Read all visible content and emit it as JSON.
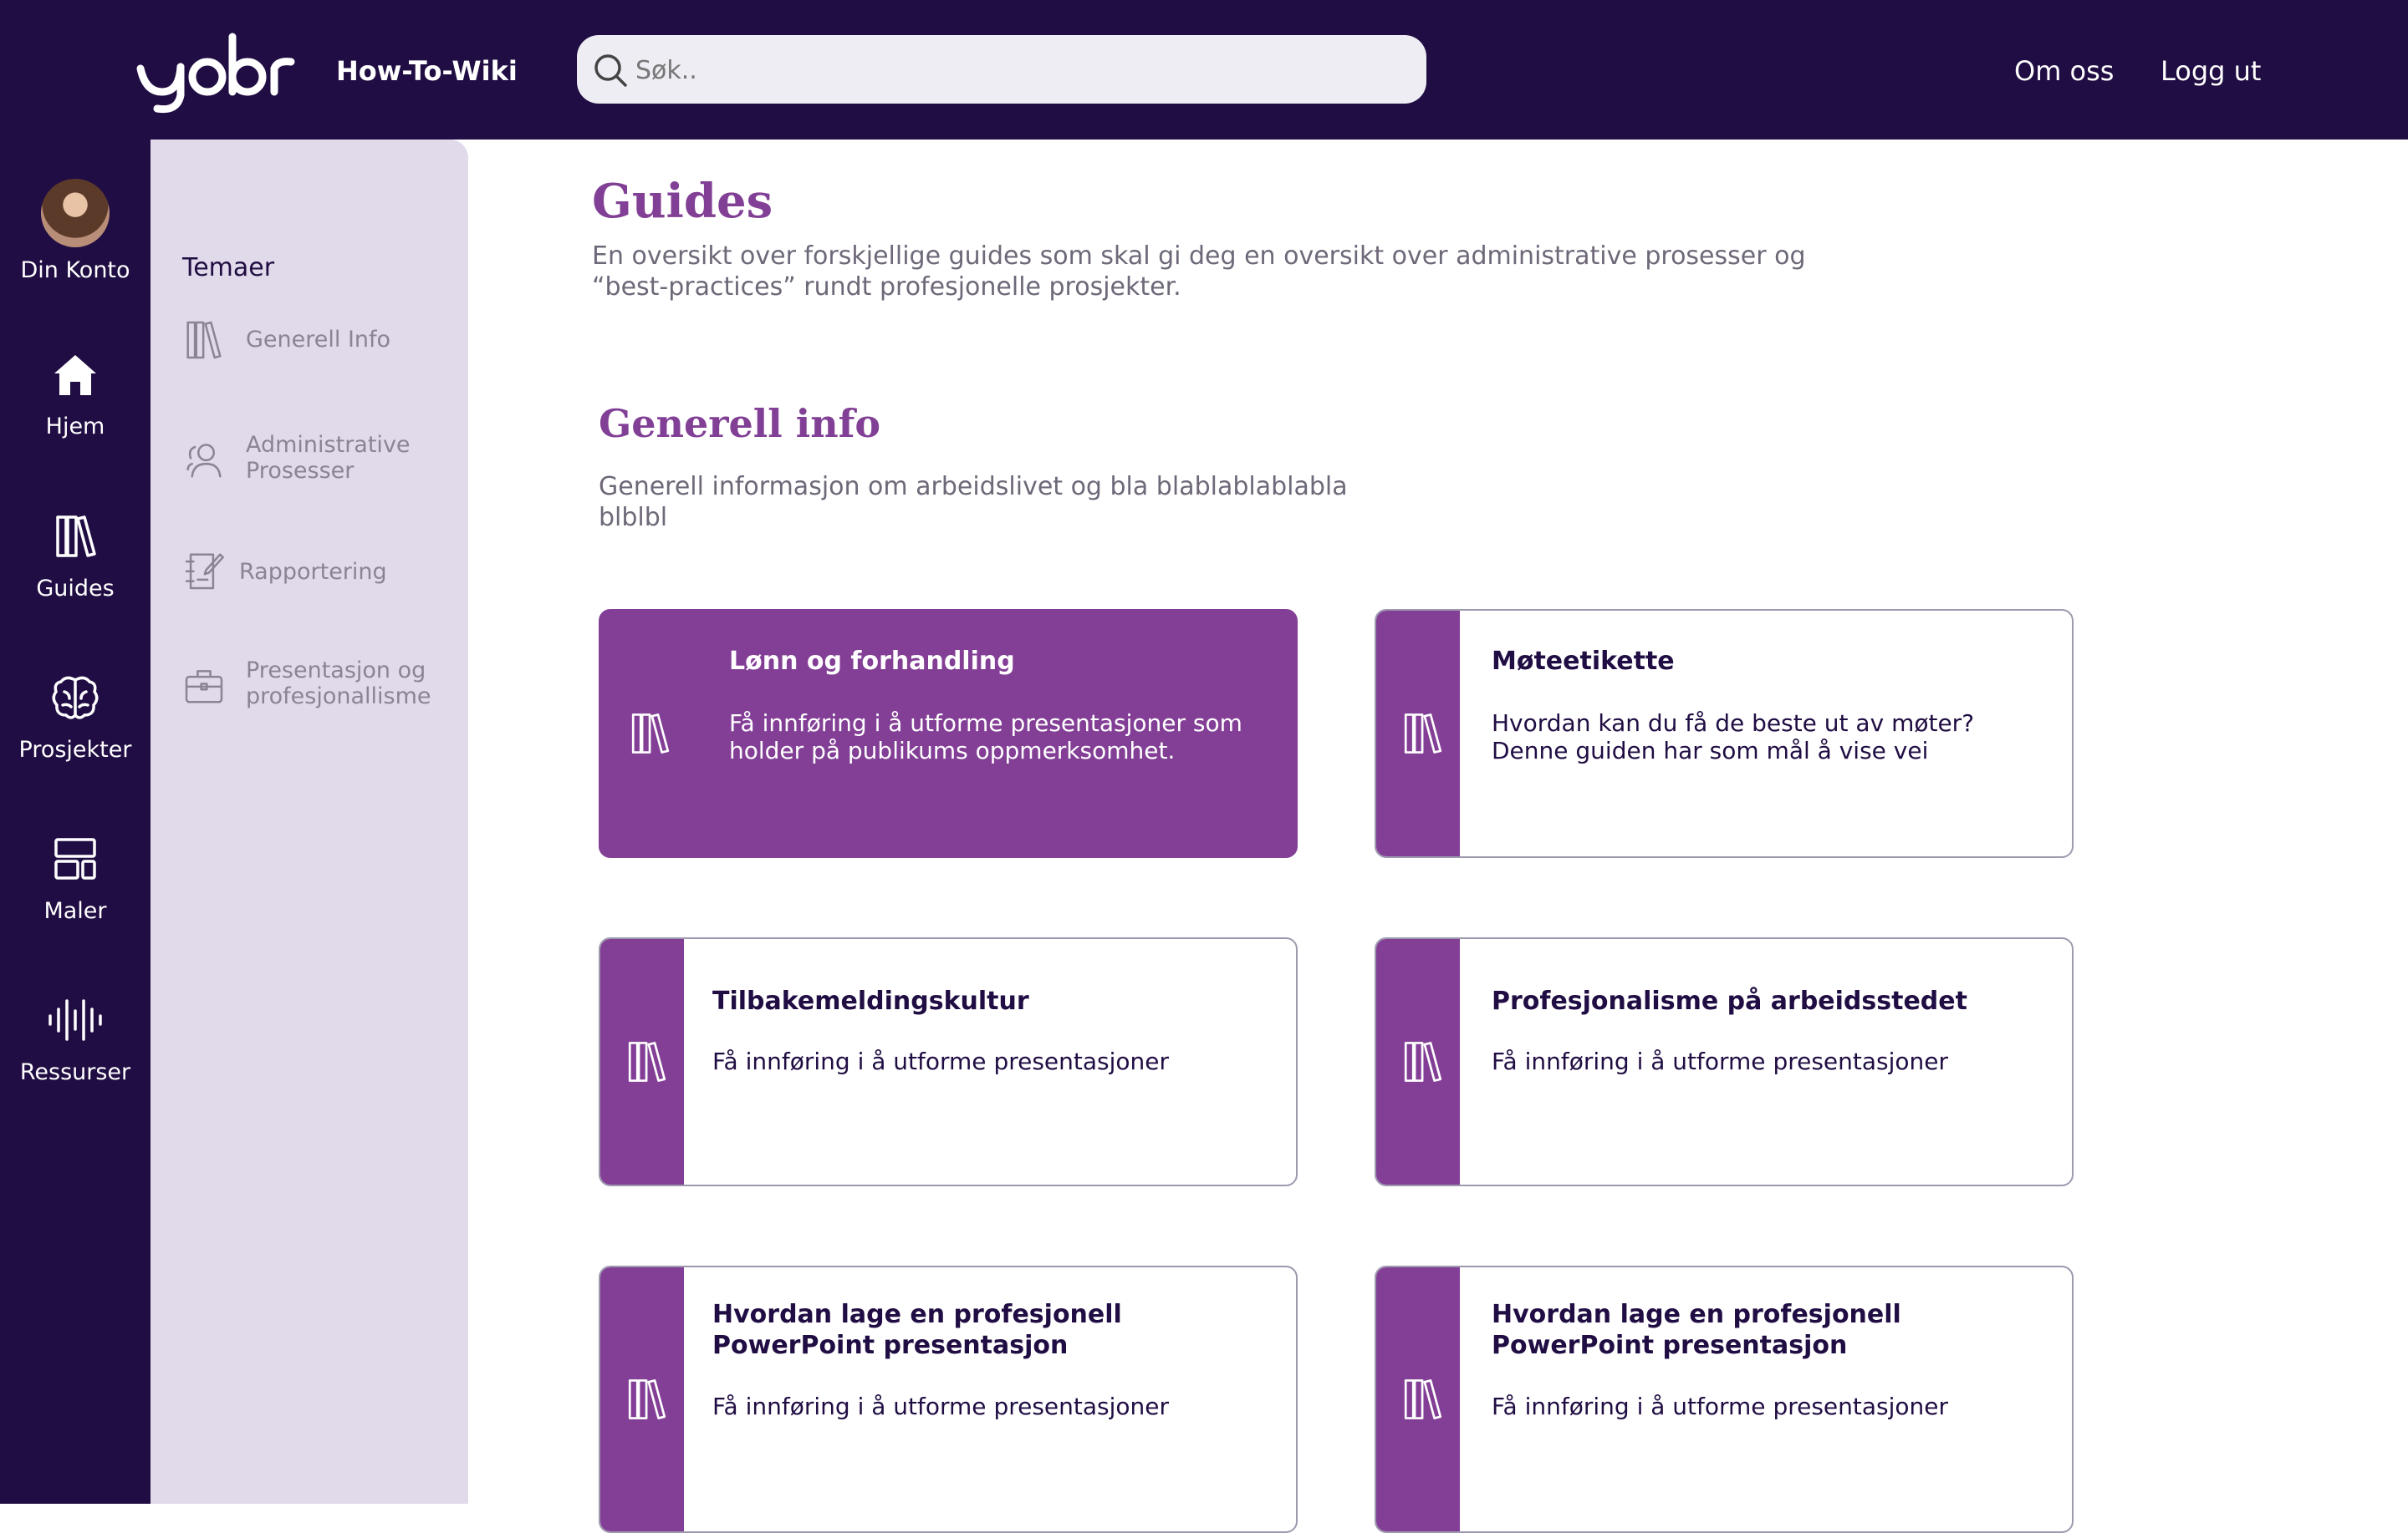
{
  "app": {
    "title": "How-To-Wiki"
  },
  "search": {
    "placeholder": "Søk.."
  },
  "top_nav": [
    {
      "label": "Om oss"
    },
    {
      "label": "Logg ut"
    }
  ],
  "rail": [
    {
      "label": "Din Konto",
      "icon": "avatar"
    },
    {
      "label": "Hjem",
      "icon": "home-icon"
    },
    {
      "label": "Guides",
      "icon": "books-icon"
    },
    {
      "label": "Prosjekter",
      "icon": "brain-icon"
    },
    {
      "label": "Maler",
      "icon": "template-icon"
    },
    {
      "label": "Ressurser",
      "icon": "audio-wave-icon"
    }
  ],
  "panel": {
    "title": "Temaer",
    "items": [
      {
        "label": "Generell Info",
        "icon": "books-icon"
      },
      {
        "label": "Administrative Prosesser",
        "icon": "users-icon"
      },
      {
        "label": "Rapportering",
        "icon": "notebook-icon"
      },
      {
        "label": "Presentasjon og profesjonallisme",
        "icon": "briefcase-icon"
      }
    ]
  },
  "main": {
    "title": "Guides",
    "description": "En oversikt over forskjellige guides som skal gi deg en oversikt over administrative prosesser og “best-practices” rundt profesjonelle prosjekter.",
    "section": {
      "title": "Generell info",
      "description": "Generell informasjon om arbeidslivet og bla blablablablabla blblbl"
    },
    "cards": [
      {
        "title": "Lønn og forhandling",
        "description": "Få innføring i å utforme presentasjoner som holder på publikums oppmerksomhet.",
        "active": true
      },
      {
        "title": "Møteetikette",
        "description": "Hvordan kan du få de beste ut av møter? Denne guiden har som mål å vise vei",
        "active": false
      },
      {
        "title": "Tilbakemeldingskultur",
        "description": "Få innføring i å utforme presentasjoner",
        "active": false
      },
      {
        "title": "Profesjonalisme på arbeidsstedet",
        "description": "Få innføring i å utforme presentasjoner",
        "active": false
      },
      {
        "title": "Hvordan lage en profesjonell PowerPoint presentasjon",
        "description": "Få innføring i å utforme presentasjoner",
        "active": false
      },
      {
        "title": "Hvordan lage en profesjonell PowerPoint presentasjon",
        "description": "Få innføring i å utforme presentasjoner",
        "active": false
      }
    ]
  },
  "colors": {
    "navy": "#200d43",
    "purple": "#833f96",
    "panel": "#e1daea"
  }
}
